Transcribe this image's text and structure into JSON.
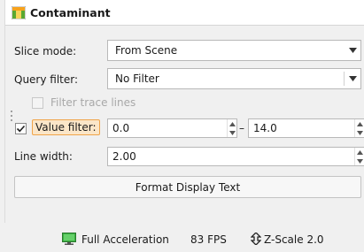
{
  "panel": {
    "title": "Contaminant",
    "slice_mode": {
      "label": "Slice mode:",
      "value": "From Scene"
    },
    "query_filter": {
      "label": "Query filter:",
      "value": "No Filter"
    },
    "filter_trace_lines": {
      "label": "Filter trace lines",
      "checked": false,
      "enabled": false
    },
    "value_filter": {
      "label": "Value filter:",
      "checked": true,
      "min": "0.0",
      "separator": "–",
      "max": "14.0"
    },
    "line_width": {
      "label": "Line width:",
      "value": "2.00"
    },
    "format_button_label": "Format Display Text"
  },
  "status_bar": {
    "acceleration": "Full Acceleration",
    "fps": "83 FPS",
    "zscale": "Z-Scale 2.0"
  },
  "colors": {
    "highlight_border": "#f0a44a",
    "highlight_fill": "#fbe6c8",
    "gpu_green": "#3cb043",
    "title_icon_orange": "#f7a21b",
    "title_icon_green": "#5aa832"
  }
}
